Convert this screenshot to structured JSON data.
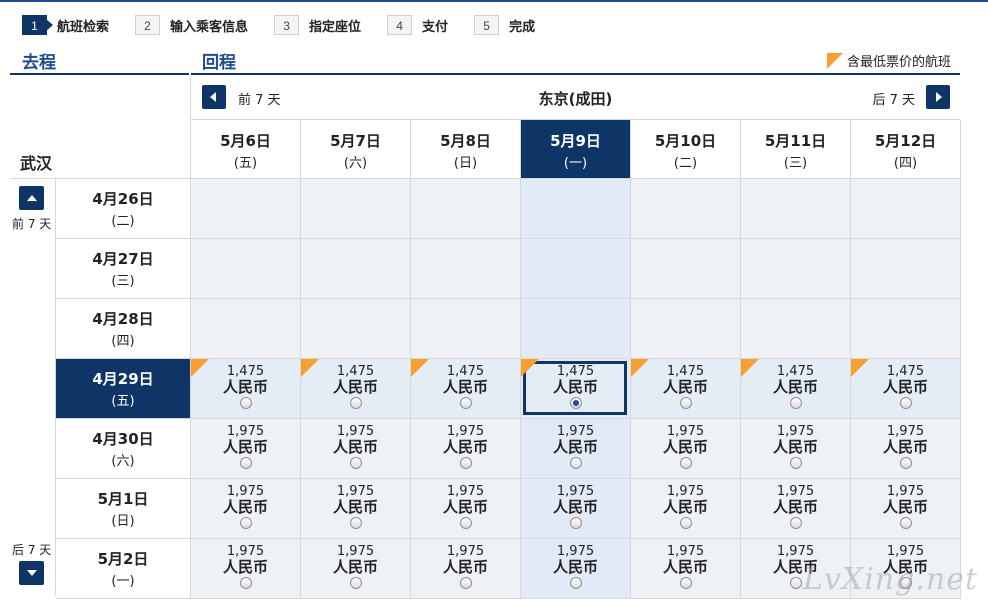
{
  "steps": [
    {
      "num": "1",
      "label": "航班检索",
      "active": true
    },
    {
      "num": "2",
      "label": "输入乘客信息",
      "active": false
    },
    {
      "num": "3",
      "label": "指定座位",
      "active": false
    },
    {
      "num": "4",
      "label": "支付",
      "active": false
    },
    {
      "num": "5",
      "label": "完成",
      "active": false
    }
  ],
  "outbound_title": "去程",
  "return_title": "回程",
  "legend_label": "含最低票价的航班",
  "route": "东京(成田)",
  "prev_7_days": "前 7 天",
  "next_7_days": "后 7 天",
  "origin_city": "武汉",
  "side_prev_label": "前 7 天",
  "side_next_label": "后 7 天",
  "accent_color": "#0f3566",
  "lowest_fare_flag_color": "#f5a030",
  "return_dates": [
    {
      "date": "5月6日",
      "weekday": "(五)"
    },
    {
      "date": "5月7日",
      "weekday": "(六)"
    },
    {
      "date": "5月8日",
      "weekday": "(日)"
    },
    {
      "date": "5月9日",
      "weekday": "(一)",
      "selected": true
    },
    {
      "date": "5月10日",
      "weekday": "(二)"
    },
    {
      "date": "5月11日",
      "weekday": "(三)"
    },
    {
      "date": "5月12日",
      "weekday": "(四)"
    }
  ],
  "outbound_dates": [
    {
      "date": "4月26日",
      "weekday": "(二)",
      "fares": null
    },
    {
      "date": "4月27日",
      "weekday": "(三)",
      "fares": null
    },
    {
      "date": "4月28日",
      "weekday": "(四)",
      "fares": null
    },
    {
      "date": "4月29日",
      "weekday": "(五)",
      "selected": true,
      "lowest": true,
      "fares": [
        "1,475",
        "1,475",
        "1,475",
        "1,475",
        "1,475",
        "1,475",
        "1,475"
      ]
    },
    {
      "date": "4月30日",
      "weekday": "(六)",
      "fares": [
        "1,975",
        "1,975",
        "1,975",
        "1,975",
        "1,975",
        "1,975",
        "1,975"
      ]
    },
    {
      "date": "5月1日",
      "weekday": "(日)",
      "fares": [
        "1,975",
        "1,975",
        "1,975",
        "1,975",
        "1,975",
        "1,975",
        "1,975"
      ]
    },
    {
      "date": "5月2日",
      "weekday": "(一)",
      "fares": [
        "1,975",
        "1,975",
        "1,975",
        "1,975",
        "1,975",
        "1,975",
        "1,975"
      ]
    }
  ],
  "currency": "人民币",
  "selected_fare": {
    "outbound": "4月29日",
    "return": "5月9日"
  },
  "watermark": "LvXing.net"
}
